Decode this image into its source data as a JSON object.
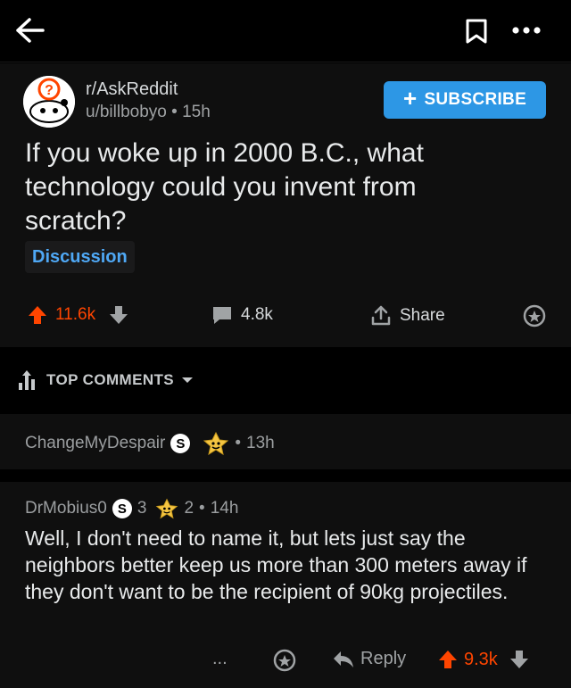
{
  "topbar": {
    "back_icon": "arrow-left-icon",
    "save_icon": "bookmark-icon",
    "more_icon": "more-horizontal-icon"
  },
  "post": {
    "subreddit": "r/AskReddit",
    "author": "u/billbobyo",
    "separator": "•",
    "age": "15h",
    "subscribe_label": "SUBSCRIBE",
    "title": "If you woke up in 2000 B.C., what technology could you invent from scratch?",
    "flair": "Discussion",
    "upvotes": "11.6k",
    "comments": "4.8k",
    "share_label": "Share"
  },
  "sort": {
    "label": "TOP COMMENTS"
  },
  "comments": [
    {
      "username": "ChangeMyDespair",
      "badge_letter": "S",
      "age": "13h"
    },
    {
      "username": "DrMobius0",
      "badge_letter": "S",
      "badge_count": "3",
      "award_count": "2",
      "age": "14h",
      "body": "Well, I don't need to name it, but lets just say the neighbors better keep us more than 300 meters away if they don't want to be the recipient of 90kg projectiles.",
      "reply_label": "Reply",
      "score": "9.3k",
      "more": "..."
    }
  ],
  "colors": {
    "accent": "#ff4500",
    "subscribe": "#2d97e5",
    "flair": "#4fa8f5",
    "background": "#000000",
    "surface": "#0f0f0f"
  }
}
